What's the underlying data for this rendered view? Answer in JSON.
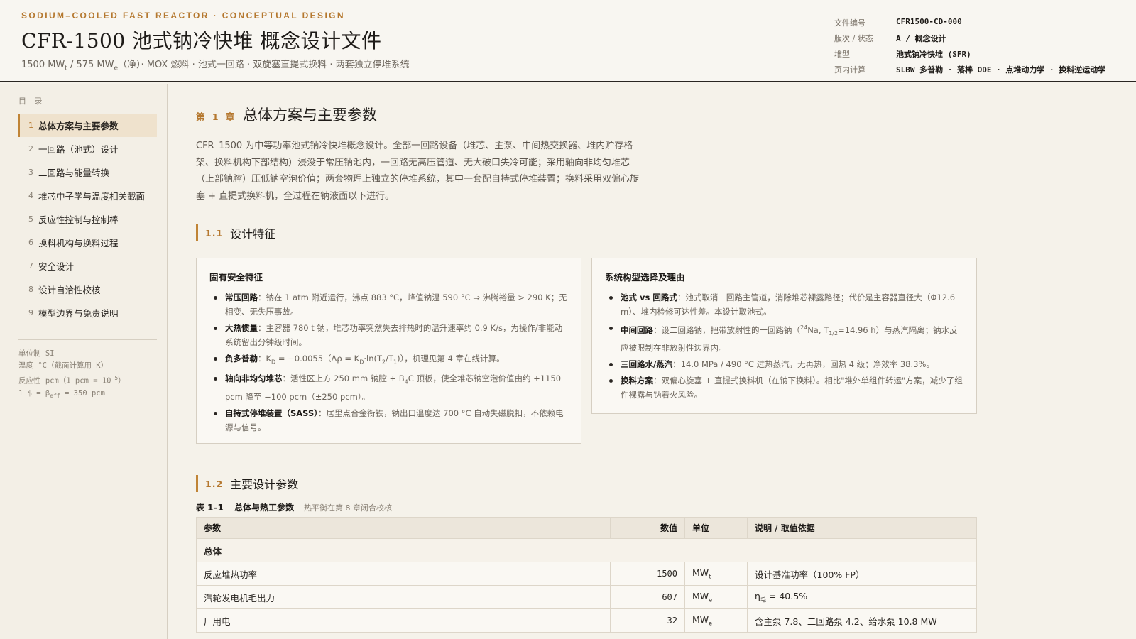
{
  "header": {
    "eyebrow": "SODIUM–COOLED FAST REACTOR · CONCEPTUAL DESIGN",
    "title": "CFR-1500 池式钠冷快堆 概念设计文件",
    "subtitle_pre": "1500 MW",
    "subtitle_sub1": "t",
    "subtitle_mid": " / 575 MW",
    "subtitle_sub2": "e",
    "subtitle_post": "（净）· MOX 燃料 · 池式一回路 · 双旋塞直提式换料 · 两套独立停堆系统"
  },
  "meta": [
    {
      "key": "文件编号",
      "value": "CFR1500-CD-000"
    },
    {
      "key": "版次 / 状态",
      "value": "A / 概念设计"
    },
    {
      "key": "堆型",
      "value": "池式钠冷快堆 (SFR)"
    },
    {
      "key": "页内计算",
      "value": "SLBW 多普勒 · 落棒 ODE · 点堆动力学 · 换料逆运动学"
    }
  ],
  "toc": {
    "label": "目 录",
    "items": [
      {
        "num": "1",
        "label": "总体方案与主要参数"
      },
      {
        "num": "2",
        "label": "一回路（池式）设计"
      },
      {
        "num": "3",
        "label": "二回路与能量转换"
      },
      {
        "num": "4",
        "label": "堆芯中子学与温度相关截面"
      },
      {
        "num": "5",
        "label": "反应性控制与控制棒"
      },
      {
        "num": "6",
        "label": "换料机构与换料过程"
      },
      {
        "num": "7",
        "label": "安全设计"
      },
      {
        "num": "8",
        "label": "设计自洽性校核"
      },
      {
        "num": "9",
        "label": "模型边界与免责说明"
      }
    ]
  },
  "units": {
    "line1": "单位制 SI",
    "line2": "温度 °C（截面计算用 K）",
    "line3_pre": "反应性 pcm（1 pcm = 10",
    "line3_sup": "−5",
    "line3_post": "）",
    "line4_pre": "1 $ = β",
    "line4_sub": "eff",
    "line4_post": " = 350 pcm"
  },
  "chapter": {
    "num": "第 1 章",
    "title": "总体方案与主要参数",
    "intro": "CFR–1500 为中等功率池式钠冷快堆概念设计。全部一回路设备（堆芯、主泵、中间热交换器、堆内贮存格架、换料机构下部结构）浸没于常压钠池内，一回路无高压管道、无大破口失冷可能；采用轴向非均匀堆芯（上部钠腔）压低钠空泡价值；两套物理上独立的停堆系统，其中一套配自持式停堆装置；换料采用双偏心旋塞 + 直提式换料机，全过程在钠液面以下进行。"
  },
  "sec11": {
    "num": "1.1",
    "title": "设计特征"
  },
  "card_left": {
    "title": "固有安全特征",
    "items": [
      {
        "bold": "常压回路",
        "text": "：钠在 1 atm 附近运行，沸点 883 °C，峰值钠温 590 °C ⇒ 沸腾裕量 > 290 K；无相变、无失压事故。"
      },
      {
        "bold": "大热惯量",
        "text": "：主容器 780 t 钠，堆芯功率突然失去排热时的温升速率约 0.9 K/s，为操作/非能动系统留出分钟级时间。"
      },
      {
        "bold": "负多普勒",
        "pre": "：K",
        "sub1": "D",
        "mid": " = −0.0055（Δρ = K",
        "sub2": "D",
        "mid2": "·ln(T",
        "sub3": "2",
        "mid3": "/T",
        "sub4": "1",
        "post": ")），机理见第 4 章在线计算。"
      },
      {
        "bold": "轴向非均匀堆芯",
        "pre": "：活性区上方 250 mm 钠腔 + B",
        "sub1": "4",
        "post": "C 顶板，使全堆芯钠空泡价值由约 +1150 pcm 降至 −100 pcm（±250 pcm）。"
      },
      {
        "bold": "自持式停堆装置（SASS）",
        "text": "：居里点合金衔铁，钠出口温度达 700 °C 自动失磁脱扣，不依赖电源与信号。"
      }
    ]
  },
  "card_right": {
    "title": "系统构型选择及理由",
    "items": [
      {
        "bold": "池式 vs 回路式",
        "text": "：池式取消一回路主管道，消除堆芯裸露路径；代价是主容器直径大（Φ12.6 m）、堆内检修可达性差。本设计取池式。"
      },
      {
        "bold": "中间回路",
        "pre": "：设二回路钠，把带放射性的一回路钠（",
        "sup1": "24",
        "mid": "Na, T",
        "sub1": "1/2",
        "post": "=14.96 h）与蒸汽隔离；钠水反应被限制在非放射性边界内。"
      },
      {
        "bold": "三回路水/蒸汽",
        "text": "：14.0 MPa / 490 °C 过热蒸汽，无再热，回热 4 级；净效率 38.3%。"
      },
      {
        "bold": "换料方案",
        "text": "：双偏心旋塞 + 直提式换料机（在钠下换料）。相比\"堆外单组件转运\"方案，减少了组件裸露与钠着火风险。"
      }
    ]
  },
  "sec12": {
    "num": "1.2",
    "title": "主要设计参数"
  },
  "table": {
    "caption_num": "表 1–1",
    "caption_title": "总体与热工参数",
    "caption_note": "热平衡在第 8 章闭合校核",
    "headers": [
      "参数",
      "数值",
      "单位",
      "说明 / 取值依据"
    ],
    "group": "总体",
    "rows": [
      {
        "param": "反应堆热功率",
        "value": "1500",
        "unit": "MW",
        "unit_sub": "t",
        "note": "设计基准功率（100% FP）"
      },
      {
        "param": "汽轮发电机毛出力",
        "value": "607",
        "unit": "MW",
        "unit_sub": "e",
        "note_pre": "η",
        "note_sub": "毛",
        "note": " = 40.5%"
      },
      {
        "param": "厂用电",
        "value": "32",
        "unit": "MW",
        "unit_sub": "e",
        "note": "含主泵 7.8、二回路泵 4.2、给水泵 10.8 MW"
      }
    ]
  }
}
